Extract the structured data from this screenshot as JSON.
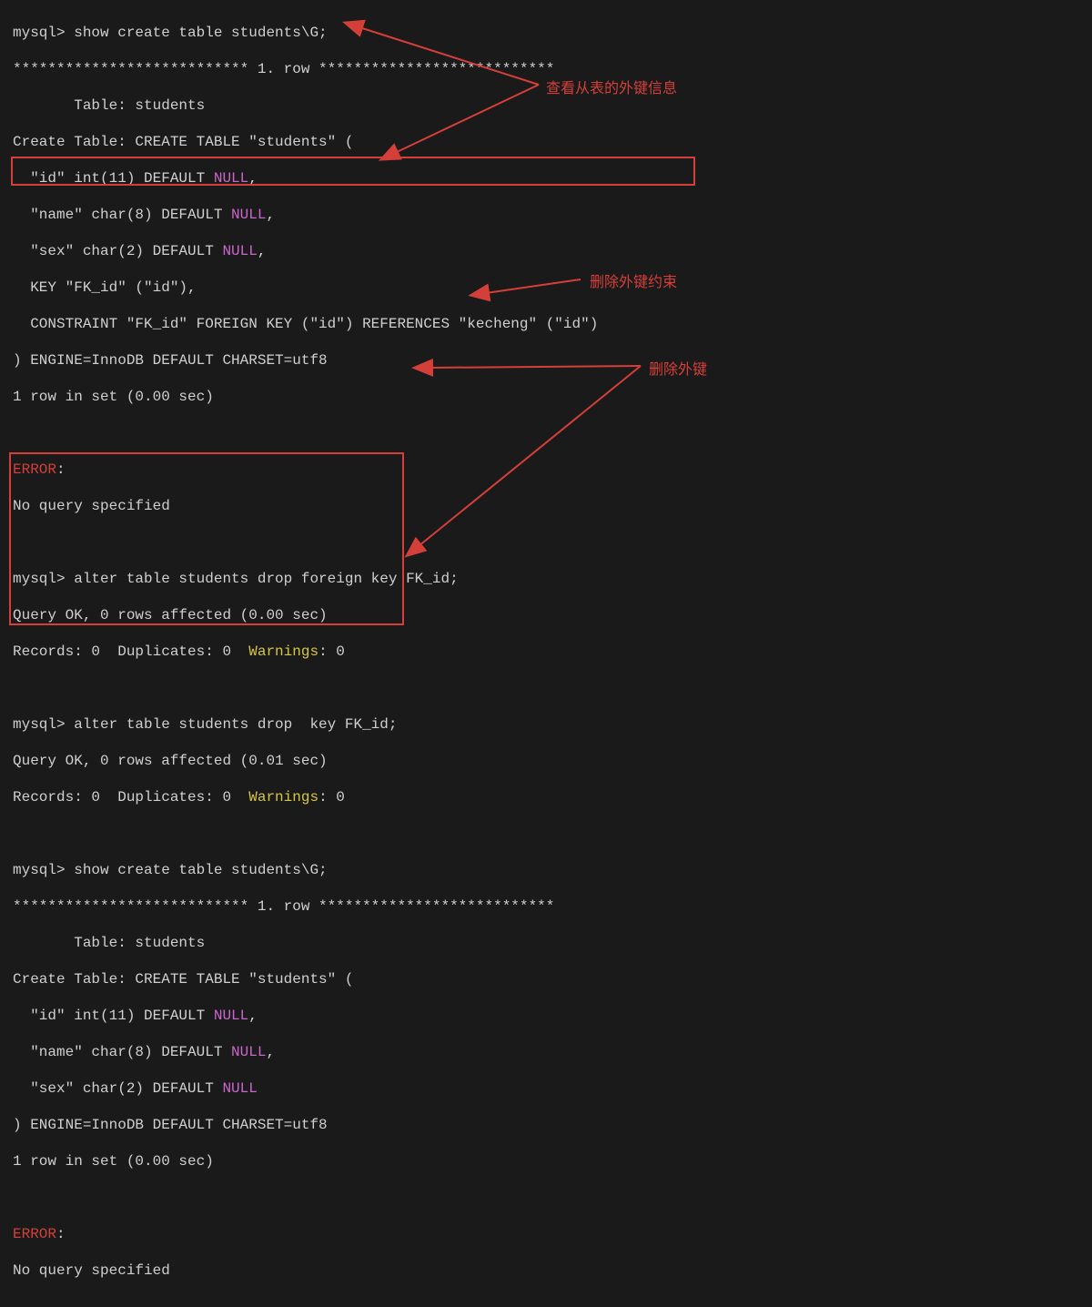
{
  "block1": {
    "cmd": "mysql> show create table students\\G;",
    "row": "*************************** 1. row ***************************",
    "table": "       Table: students",
    "ct1": "Create Table: CREATE TABLE \"students\" (",
    "id_pre": "  \"id\" int(11) DEFAULT ",
    "null": "NULL",
    "comma": ",",
    "name_pre": "  \"name\" char(8) DEFAULT ",
    "sex_pre": "  \"sex\" char(2) DEFAULT ",
    "keyline": "  KEY \"FK_id\" (\"id\"),",
    "constraint": "  CONSTRAINT \"FK_id\" FOREIGN KEY (\"id\") REFERENCES \"kecheng\" (\"id\")",
    "engine": ") ENGINE=InnoDB DEFAULT CHARSET=utf8",
    "rowin": "1 row in set (0.00 sec)"
  },
  "err": {
    "label": "ERROR",
    "colon": ":",
    "msg": "No query specified"
  },
  "block2": {
    "cmd": "mysql> alter table students drop foreign key FK_id;",
    "ok": "Query OK, 0 rows affected (0.00 sec)",
    "rec_pre": "Records: 0  Duplicates: 0  ",
    "warn": "Warnings",
    "rec_post": ": 0"
  },
  "block3": {
    "cmd": "mysql> alter table students drop  key FK_id;",
    "ok": "Query OK, 0 rows affected (0.01 sec)",
    "rec_pre": "Records: 0  Duplicates: 0  ",
    "warn": "Warnings",
    "rec_post": ": 0"
  },
  "block4": {
    "cmd": "mysql> show create table students\\G;",
    "row": "*************************** 1. row ***************************",
    "table": "       Table: students",
    "ct1": "Create Table: CREATE TABLE \"students\" (",
    "id_pre": "  \"id\" int(11) DEFAULT ",
    "null": "NULL",
    "comma": ",",
    "name_pre": "  \"name\" char(8) DEFAULT ",
    "sex_pre": "  \"sex\" char(2) DEFAULT ",
    "engine": ") ENGINE=InnoDB DEFAULT CHARSET=utf8",
    "rowin": "1 row in set (0.00 sec)"
  },
  "annotations": {
    "a1": "查看从表的外键信息",
    "a2": "删除外键约束",
    "a3": "删除外键"
  }
}
